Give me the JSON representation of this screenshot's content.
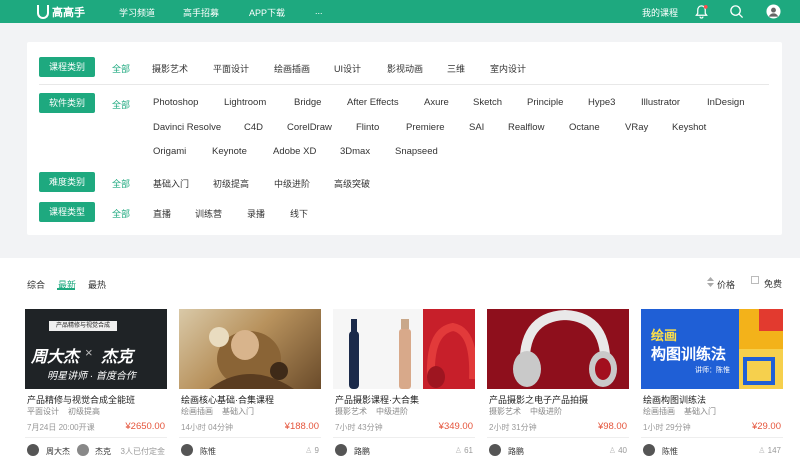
{
  "app": {
    "logo": "高高手"
  },
  "nav": {
    "items": [
      "学习频道",
      "高手招募",
      "APP下载",
      "..."
    ],
    "my_courses": "我的课程"
  },
  "filters": {
    "course_category": {
      "label": "课程类别",
      "all": "全部",
      "options": [
        "摄影艺术",
        "平面设计",
        "绘画插画",
        "UI设计",
        "影视动画",
        "三维",
        "室内设计"
      ]
    },
    "software_category": {
      "label": "软件类别",
      "all": "全部",
      "options": [
        "Photoshop",
        "Lightroom",
        "Bridge",
        "After Effects",
        "Axure",
        "Sketch",
        "Principle",
        "Hype3",
        "Illustrator",
        "InDesign",
        "Davinci Resolve",
        "C4D",
        "CorelDraw",
        "Flinto",
        "Premiere",
        "SAI",
        "Realflow",
        "Octane",
        "VRay",
        "Keyshot",
        "Origami",
        "Keynote",
        "Adobe XD",
        "3Dmax",
        "Snapseed"
      ]
    },
    "difficulty": {
      "label": "难度类别",
      "all": "全部",
      "options": [
        "基础入门",
        "初级提高",
        "中级进阶",
        "高级突破"
      ]
    },
    "course_type": {
      "label": "课程类型",
      "all": "全部",
      "options": [
        "直播",
        "训练营",
        "录播",
        "线下"
      ]
    }
  },
  "sort": {
    "tabs": [
      "综合",
      "最新",
      "最热"
    ],
    "active": "最新",
    "price": "价格",
    "free": "免费"
  },
  "courses": [
    {
      "title": "产品精修与视觉合成全能班",
      "tags": [
        "平面设计",
        "初级提高"
      ],
      "time": "7月24日 20:00开课",
      "price": "¥2650.00",
      "teachers": [
        "周大杰",
        "杰克"
      ],
      "count": "3人已付定金",
      "thumb_text1": "周大杰",
      "thumb_text2": "杰克",
      "thumb_text3": "明星讲师 · 首度合作",
      "thumb_text4": "产品精修与视觉合成"
    },
    {
      "title": "绘画核心基础·合集课程",
      "tags": [
        "绘画插画",
        "基础入门"
      ],
      "time": "14小时 04分钟",
      "price": "¥188.00",
      "teachers": [
        "陈惟"
      ],
      "count": "9"
    },
    {
      "title": "产品摄影课程·大合集",
      "tags": [
        "摄影艺术",
        "中级进阶"
      ],
      "time": "7小时 43分钟",
      "price": "¥349.00",
      "teachers": [
        "路鹏"
      ],
      "count": "61"
    },
    {
      "title": "产品摄影之电子产品拍摄",
      "tags": [
        "摄影艺术",
        "中级进阶"
      ],
      "time": "2小时 31分钟",
      "price": "¥98.00",
      "teachers": [
        "路鹏"
      ],
      "count": "40"
    },
    {
      "title": "绘画构图训练法",
      "tags": [
        "绘画插画",
        "基础入门"
      ],
      "time": "1小时 29分钟",
      "price": "¥29.00",
      "teachers": [
        "陈惟"
      ],
      "count": "147",
      "thumb_text1": "绘画",
      "thumb_text2": "构图训练法",
      "thumb_text3": "讲师：陈惟"
    }
  ],
  "colors": {
    "brand": "#1ea97f",
    "price": "#e5553c"
  }
}
